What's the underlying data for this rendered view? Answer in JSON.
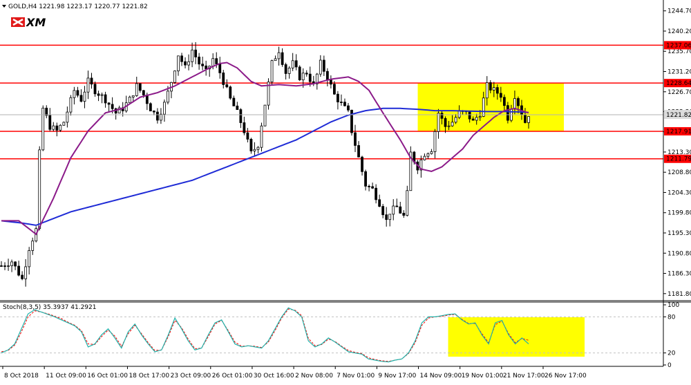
{
  "header": {
    "symbol_line": "GOLD,H4  1221.98 1223.17 1220.77 1221.82",
    "logo_text": "XM"
  },
  "indicator": {
    "label": "Stoch(8,3,5) 35.3937 41.2921"
  },
  "colors": {
    "background": "#ffffff",
    "candle": "#000000",
    "ma_fast": "#8b1a89",
    "ma_slow": "#1f2bd6",
    "level_line": "#ff0000",
    "level_label_bg": "#ff0000",
    "highlight": "#ffff00",
    "stoch_main": "#20b2aa",
    "stoch_signal": "#ff0000",
    "current_price_bg": "#dcdcdc"
  },
  "chart_data": [
    {
      "type": "candlestick",
      "title": "GOLD,H4",
      "ylim": [
        1181.0,
        1246.5
      ],
      "y_ticks": [
        "1244.70",
        "1240.20",
        "1235.70",
        "1231.20",
        "1226.70",
        "1222.30",
        "1217.80",
        "1213.30",
        "1208.80",
        "1204.30",
        "1199.80",
        "1195.30",
        "1190.80",
        "1186.30",
        "1181.80"
      ],
      "x_ticks": [
        "8 Oct 2018",
        "11 Oct 09:00",
        "16 Oct 01:00",
        "18 Oct 17:00",
        "23 Oct 09:00",
        "26 Oct 01:00",
        "30 Oct 16:00",
        "2 Nov 08:00",
        "7 Nov 01:00",
        "9 Nov 17:00",
        "14 Nov 09:00",
        "19 Nov 01:00",
        "21 Nov 17:00",
        "26 Nov 17:00"
      ],
      "levels": [
        "1237.06",
        "1228.64",
        "1217.91",
        "1211.79"
      ],
      "current_price": "1221.82",
      "highlight_zone": {
        "from_tick": "14 Nov 09:00",
        "to_tick": "26 Nov 17:00",
        "price_low": 1217.91,
        "price_high": 1228.64
      },
      "close_path": [
        [
          0,
          1188
        ],
        [
          3,
          1189
        ],
        [
          6,
          1185
        ],
        [
          8,
          1192
        ],
        [
          10,
          1196
        ],
        [
          11,
          1213
        ],
        [
          12,
          1223
        ],
        [
          14,
          1219
        ],
        [
          16,
          1218
        ],
        [
          18,
          1220
        ],
        [
          21,
          1227
        ],
        [
          23,
          1225
        ],
        [
          25,
          1229
        ],
        [
          27,
          1227
        ],
        [
          30,
          1225
        ],
        [
          33,
          1222
        ],
        [
          35,
          1223
        ],
        [
          37,
          1225
        ],
        [
          39,
          1228
        ],
        [
          41,
          1226
        ],
        [
          43,
          1223
        ],
        [
          45,
          1221
        ],
        [
          47,
          1224
        ],
        [
          49,
          1229
        ],
        [
          51,
          1235
        ],
        [
          53,
          1232
        ],
        [
          55,
          1236
        ],
        [
          57,
          1233
        ],
        [
          59,
          1231
        ],
        [
          61,
          1234
        ],
        [
          63,
          1231
        ],
        [
          64,
          1229
        ],
        [
          66,
          1225
        ],
        [
          68,
          1222
        ],
        [
          70,
          1218
        ],
        [
          72,
          1213
        ],
        [
          74,
          1215
        ],
        [
          76,
          1224
        ],
        [
          78,
          1233
        ],
        [
          80,
          1236
        ],
        [
          82,
          1231
        ],
        [
          84,
          1233
        ],
        [
          86,
          1230
        ],
        [
          88,
          1231
        ],
        [
          90,
          1228
        ],
        [
          92,
          1233
        ],
        [
          94,
          1230
        ],
        [
          96,
          1226
        ],
        [
          98,
          1224
        ],
        [
          100,
          1222
        ],
        [
          101,
          1218
        ],
        [
          103,
          1212
        ],
        [
          105,
          1206
        ],
        [
          107,
          1205
        ],
        [
          109,
          1202
        ],
        [
          111,
          1198
        ],
        [
          112,
          1200
        ],
        [
          114,
          1201
        ],
        [
          116,
          1199
        ],
        [
          117,
          1204
        ],
        [
          118,
          1213
        ],
        [
          120,
          1210
        ],
        [
          122,
          1213
        ],
        [
          124,
          1214
        ],
        [
          126,
          1222
        ],
        [
          128,
          1219
        ],
        [
          130,
          1220
        ],
        [
          132,
          1222
        ],
        [
          134,
          1222
        ],
        [
          136,
          1220
        ],
        [
          138,
          1222
        ],
        [
          140,
          1228
        ],
        [
          142,
          1227
        ],
        [
          144,
          1226
        ],
        [
          146,
          1221
        ],
        [
          148,
          1226
        ],
        [
          150,
          1222
        ],
        [
          151,
          1220
        ],
        [
          152,
          1221.8
        ]
      ],
      "ma_fast_path": [
        [
          0,
          1198
        ],
        [
          5,
          1198
        ],
        [
          10,
          1195
        ],
        [
          15,
          1203
        ],
        [
          20,
          1212
        ],
        [
          25,
          1218
        ],
        [
          30,
          1222
        ],
        [
          35,
          1223
        ],
        [
          40,
          1225.5
        ],
        [
          45,
          1226.5
        ],
        [
          50,
          1228
        ],
        [
          55,
          1230
        ],
        [
          60,
          1232
        ],
        [
          63,
          1233
        ],
        [
          65,
          1233.2
        ],
        [
          68,
          1232
        ],
        [
          72,
          1229
        ],
        [
          75,
          1228
        ],
        [
          80,
          1228.3
        ],
        [
          85,
          1228
        ],
        [
          90,
          1228.5
        ],
        [
          95,
          1229.5
        ],
        [
          100,
          1230
        ],
        [
          103,
          1229
        ],
        [
          106,
          1227
        ],
        [
          110,
          1222
        ],
        [
          115,
          1216
        ],
        [
          118,
          1212
        ],
        [
          121,
          1209.5
        ],
        [
          124,
          1209
        ],
        [
          127,
          1210
        ],
        [
          130,
          1212
        ],
        [
          133,
          1214
        ],
        [
          136,
          1217
        ],
        [
          139,
          1219
        ],
        [
          142,
          1221
        ],
        [
          145,
          1222.5
        ],
        [
          148,
          1223
        ],
        [
          150,
          1222.5
        ],
        [
          152,
          1222
        ]
      ],
      "ma_slow_path": [
        [
          0,
          1198
        ],
        [
          6,
          1197.5
        ],
        [
          10,
          1197
        ],
        [
          15,
          1198.5
        ],
        [
          20,
          1200
        ],
        [
          30,
          1202
        ],
        [
          40,
          1204
        ],
        [
          50,
          1206
        ],
        [
          55,
          1207
        ],
        [
          60,
          1208.5
        ],
        [
          65,
          1210
        ],
        [
          70,
          1211.5
        ],
        [
          75,
          1213
        ],
        [
          80,
          1214.5
        ],
        [
          85,
          1216
        ],
        [
          90,
          1218
        ],
        [
          95,
          1220
        ],
        [
          100,
          1221.5
        ],
        [
          105,
          1222.5
        ],
        [
          110,
          1223
        ],
        [
          115,
          1223
        ],
        [
          120,
          1222.8
        ],
        [
          125,
          1222.5
        ],
        [
          130,
          1222.5
        ],
        [
          135,
          1222.4
        ],
        [
          140,
          1222.3
        ],
        [
          145,
          1222.3
        ],
        [
          150,
          1222.2
        ],
        [
          152,
          1222.1
        ]
      ]
    },
    {
      "type": "line",
      "title": "Stoch(8,3,5) 35.3937 41.2921",
      "ylim": [
        0,
        100
      ],
      "y_ticks": [
        "100",
        "80",
        "20",
        "0"
      ],
      "series": [
        {
          "name": "",
          "values": [
            20,
            25,
            35,
            60,
            85,
            92,
            88,
            84,
            80,
            75,
            70,
            65,
            55,
            30,
            35,
            50,
            60,
            45,
            28,
            55,
            68,
            50,
            35,
            22,
            25,
            50,
            78,
            60,
            40,
            25,
            28,
            50,
            70,
            75,
            55,
            35,
            30,
            32,
            30,
            28,
            40,
            60,
            80,
            95,
            90,
            80,
            40,
            30,
            35,
            45,
            38,
            30,
            22,
            20,
            18,
            10,
            8,
            6,
            5,
            8,
            10,
            20,
            40,
            70,
            80,
            80,
            82,
            84,
            85,
            75,
            68,
            70,
            50,
            35,
            70,
            74,
            50,
            35,
            45,
            35
          ]
        },
        {
          "name": "",
          "values": [
            22,
            24,
            33,
            55,
            80,
            90,
            88,
            85,
            81,
            77,
            71,
            66,
            57,
            35,
            34,
            47,
            58,
            48,
            31,
            52,
            66,
            52,
            37,
            24,
            25,
            47,
            74,
            62,
            43,
            27,
            28,
            47,
            68,
            74,
            57,
            38,
            31,
            32,
            31,
            29,
            38,
            57,
            78,
            93,
            91,
            82,
            44,
            32,
            34,
            43,
            39,
            31,
            24,
            21,
            19,
            12,
            9,
            7,
            6,
            8,
            10,
            19,
            37,
            66,
            78,
            80,
            81,
            83,
            84,
            76,
            69,
            69,
            52,
            37,
            67,
            73,
            52,
            37,
            44,
            41
          ]
        }
      ]
    }
  ]
}
